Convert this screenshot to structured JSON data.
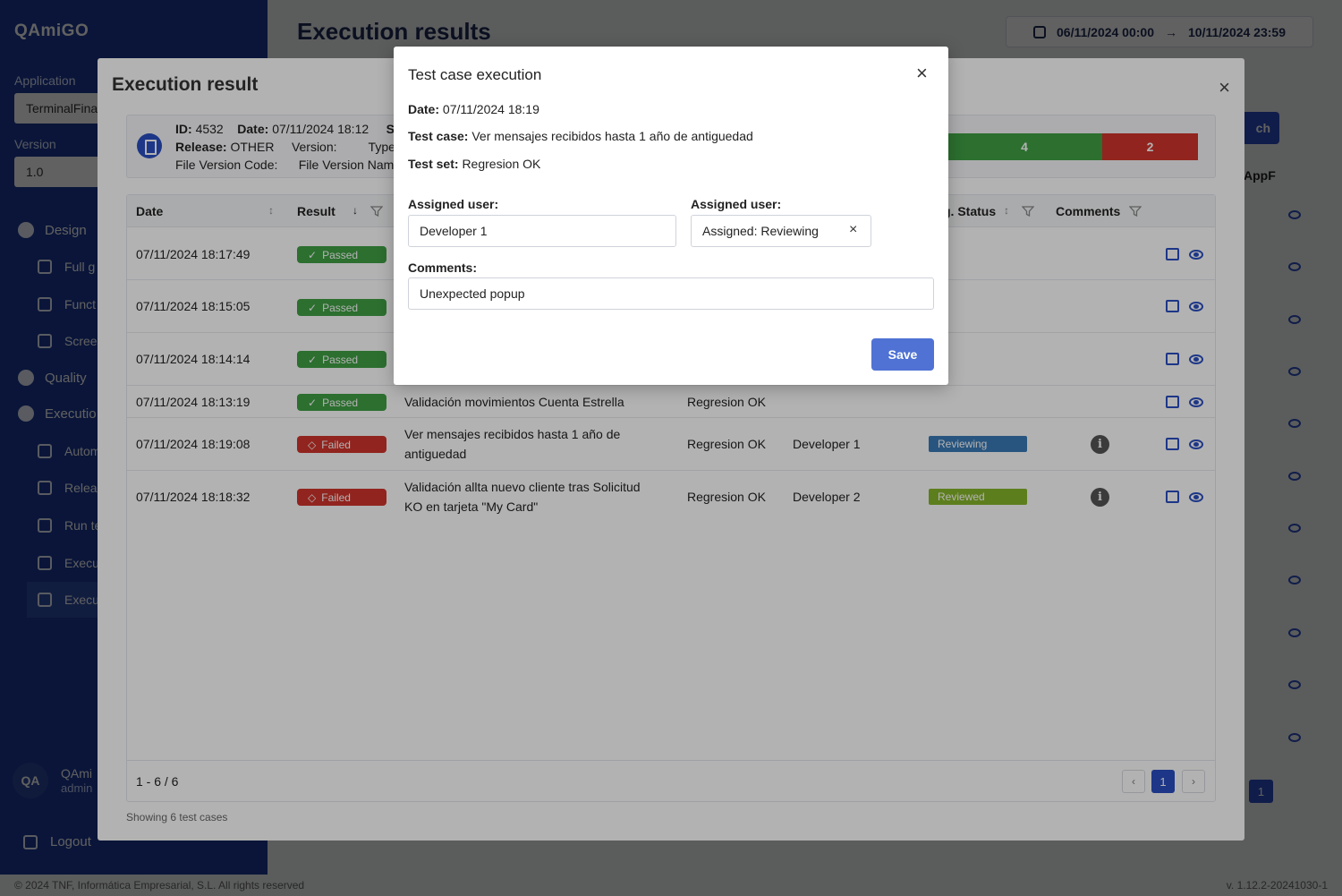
{
  "app": {
    "brand": "QAmiGO",
    "application_label": "Application",
    "application_value": "TerminalFina",
    "version_label": "Version",
    "version_value": "1.0",
    "nav": {
      "design": "Design",
      "full": "Full g",
      "func": "Funct",
      "scree": "Scree",
      "quality": "Quality",
      "execution": "Executio",
      "auto": "Autom",
      "relea": "Relea",
      "run": "Run te",
      "execu1": "Execu",
      "execu2": "Execu"
    },
    "user_initials": "QA",
    "user_name": "QAmi",
    "user_role": "admin",
    "logout": "Logout",
    "page_title": "Execution results",
    "date_from": "06/11/2024 00:00",
    "date_to": "10/11/2024 23:59",
    "search_btn": "ch",
    "bg_col": "AppF",
    "bg_page": "1",
    "footer_left": "© 2024 TNF, Informática Empresarial, S.L. All rights reserved",
    "footer_right": "v. 1.12.2-20241030-1"
  },
  "exec_modal": {
    "title": "Execution result",
    "close": "×",
    "info": {
      "id_label": "ID:",
      "id_value": "4532",
      "date_label": "Date:",
      "date_value": "07/11/2024 18:12",
      "s_trunc": "S",
      "release_label": "Release:",
      "release_value": "OTHER",
      "version_label": "Version:",
      "type_label": "Type:",
      "fvc_label": "File Version Code:",
      "fvn_label": "File Version Nam"
    },
    "passed_count": "4",
    "failed_count": "2",
    "colors": {
      "passed": "#3f9f44",
      "failed": "#d0342c",
      "reviewing": "#3a7ab6",
      "reviewed": "#86b52a",
      "accent": "#2a4ec2"
    },
    "columns": {
      "date": "Date",
      "result": "Result",
      "status": "g. Status",
      "comments": "Comments"
    },
    "rows": [
      {
        "date": "07/11/2024 18:17:49",
        "result": "Passed",
        "test_case": "",
        "test_set": "",
        "user": "",
        "status": ""
      },
      {
        "date": "07/11/2024 18:15:05",
        "result": "Passed",
        "test_case": "",
        "test_set": "",
        "user": "",
        "status": ""
      },
      {
        "date": "07/11/2024 18:14:14",
        "result": "Passed",
        "test_case": "",
        "test_set": "",
        "user": "",
        "status": ""
      },
      {
        "date": "07/11/2024 18:13:19",
        "result": "Passed",
        "test_case": "Validación movimientos Cuenta Estrella",
        "test_set": "Regresion OK",
        "user": "",
        "status": ""
      },
      {
        "date": "07/11/2024 18:19:08",
        "result": "Failed",
        "test_case_l1": "Ver mensajes recibidos hasta 1 año de",
        "test_case_l2": "antiguedad",
        "test_set": "Regresion OK",
        "user": "Developer 1",
        "status": "Reviewing"
      },
      {
        "date": "07/11/2024 18:18:32",
        "result": "Failed",
        "test_case_l1": "Validación allta nuevo cliente tras Solicitud",
        "test_case_l2": "KO en tarjeta \"My Card\"",
        "test_set": "Regresion OK",
        "user": "Developer 2",
        "status": "Reviewed"
      }
    ],
    "page_count": "1 - 6 / 6",
    "current_page": "1",
    "prev": "‹",
    "next": "›",
    "showing": "Showing 6 test cases"
  },
  "dialog": {
    "title": "Test case execution",
    "close": "×",
    "date_label": "Date:",
    "date_value": "07/11/2024 18:19",
    "test_case_label": "Test case:",
    "test_case_value": "Ver mensajes recibidos hasta 1 año de antiguedad",
    "test_set_label": "Test set:",
    "test_set_value": "Regresion OK",
    "assigned_user_label": "Assigned user:",
    "assigned_user_value": "Developer 1",
    "assigned_status_label": "Assigned user:",
    "assigned_status_value": "Assigned: Reviewing",
    "clear": "×",
    "comments_label": "Comments:",
    "comments_value": "Unexpected popup",
    "save": "Save"
  }
}
